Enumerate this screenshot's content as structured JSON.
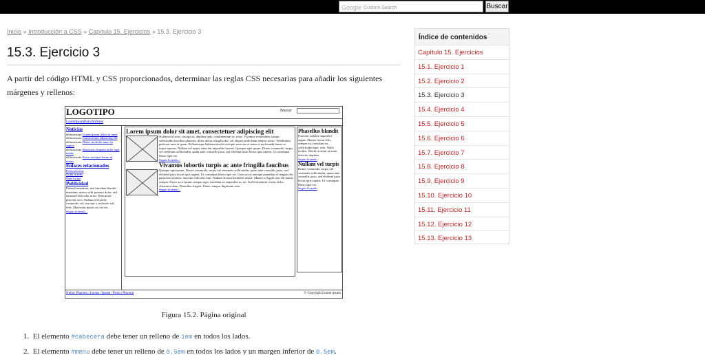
{
  "search": {
    "google_label": "Google",
    "placeholder": "Custom Search",
    "button": "Buscar"
  },
  "breadcrumb": {
    "items": [
      "Inicio",
      "Introducción a CSS",
      "Capítulo 15. Ejercicios"
    ],
    "current": "15.3. Ejercicio 3",
    "separator": "»"
  },
  "page": {
    "title": "15.3. Ejercicio 3",
    "intro": "A partir del código HTML y CSS proporcionados, determinar las reglas CSS necesarias para añadir los siguientes márgenes y rellenos:"
  },
  "figure": {
    "logo": "LOGOTIPO",
    "buscar": "Buscar",
    "menu": "LoremIpsumDolorSitAmet",
    "left": {
      "h1": "Noticias",
      "news": [
        {
          "date": "dd/mm/aaaa",
          "link": "Lorem ipsum dolor sit amet"
        },
        {
          "date": "dd/mm/aaaa",
          "link": "Consectetuer adipiscing elit"
        },
        {
          "date": "dd/mm/aaaa",
          "link": "Donec molestie nunc eu sapien"
        },
        {
          "date": "dd/mm/aaaa",
          "link": "Maecenas aliquam dolor eget metus"
        },
        {
          "date": "dd/mm/aaaa",
          "link": "Fusce tristique lorem id metus"
        }
      ],
      "h2": "Enlaces relacionados",
      "links": [
        "Proin placerat",
        "Nulla in felis",
        "Nam luctus"
      ],
      "h3": "Publicidad",
      "ad_text": "Etiam fermentum, nisl tincidunt blandit interdum, massa velit posuere dolor, sed euismod sem odio at mi. Duis porta placerat arcu. Nullam felis pede, commodo vel, suscipit a, molestie vel, felis. Maecenas mattis est vel est.",
      "more": "Seguir leyendo..."
    },
    "center": {
      "h1": "Lorem ipsum dolor sit amet, consectetuer adipiscing elit",
      "p1": "Nullam est lacus, suscipit ut, dapibus quis, condimentum ac, risus. Vivamus vestibulum, ipsum sollicitudin faucibus pharetra, dolor metus fringilla dui, vel aliquet pede diam tempor tortor. Vestibulum pulvinar urna et quam. Pellentesque habitant morbi tristique senectus et netus et malesuada fames ac turpis egestas. Nullam vel turpis vitae dui imperdiet laoreet. Quisque eget ipsum. Donec commodo, turpis vel venenatis sollicitudin, quam ante convallis justo, sed eleifend justo lectus quis sapien. Ut consequat libero eget est.",
      "more1": "Seguir leyendo...",
      "h2": "Vivamus lobortis turpis ac ante fringilla faucibus",
      "p2": "Quisque eget ipsum. Donec commodo, turpis vel venenatis sollicitudin, quam ante convallis justo, sed eleifend justo lectus quis sapien. Ut consequat libero eget est. Cum sociis natoque penatibus et magnis dis parturient montes, nascetur ridiculus mus. Nullam dictum hendrerit neque. Mauris id ligula non elit mattis semper. Fusce arcu ipsum, tempus eget, tincidunt at, imperdiet in, mi. Sed fermentum cursus dolor. Aenean a diam. Phasellus feugiat. Donec tempor dignissim sem.",
      "more2": "Seguir leyendo..."
    },
    "right": {
      "h1": "Phasellus blandit",
      "p1": "Praesent sodales imperdiet augue. Mauris lorem felis, semper eu, tincidunt eu, sollicitudin eget, sem. Nulla facilisi. Morbi ut enim ut enim ultricies dapibus.",
      "more1": "Seguir leyendo",
      "h2": "Nullam vel turpis",
      "p2": "Donec commodo, turpis vel venenatis sollicitudin, quam ante convallis justo, sed eleifend justo lectus quis sapien. Ut consequat libero eget est.",
      "more2": "Seguir leyendo"
    },
    "footer": {
      "links": "Nulla | Pharetra | Luctus | Ipsum | Proin | Placerat",
      "copyright": "© Copyright Lorem ipsum"
    }
  },
  "caption": "Figura 15.2. Página original",
  "steps": [
    {
      "num": "1.",
      "pre": "El elemento ",
      "code1": "#cabecera",
      "mid": " debe tener un relleno de ",
      "code2": "1em",
      "mid2": " en todos los lados.",
      "code3": "",
      "post": ""
    },
    {
      "num": "2.",
      "pre": "El elemento ",
      "code1": "#menu",
      "mid": " debe tener un relleno de ",
      "code2": "0.5em",
      "mid2": " en todos los lados y un margen inferior de ",
      "code3": "0.5em",
      "post": "."
    }
  ],
  "toc": {
    "heading": "Índice de contenidos",
    "items": [
      "Capítulo 15. Ejercicios",
      "15.1. Ejercicio 1",
      "15.2. Ejercicio 2",
      "15.3. Ejercicio 3",
      "15.4. Ejercicio 4",
      "15.5. Ejercicio 5",
      "15.6. Ejercicio 6",
      "15.7. Ejercicio 7",
      "15.8. Ejercicio 8",
      "15.9. Ejercicio 9",
      "15.10. Ejercicio 10",
      "15.11. Ejercicio 11",
      "15.12. Ejercicio 12",
      "15.13. Ejercicio 13"
    ],
    "current_index": 3
  },
  "colors": {
    "link_red": "#bb2222",
    "code_blue": "#4a86c5",
    "topbar": "#000000"
  }
}
